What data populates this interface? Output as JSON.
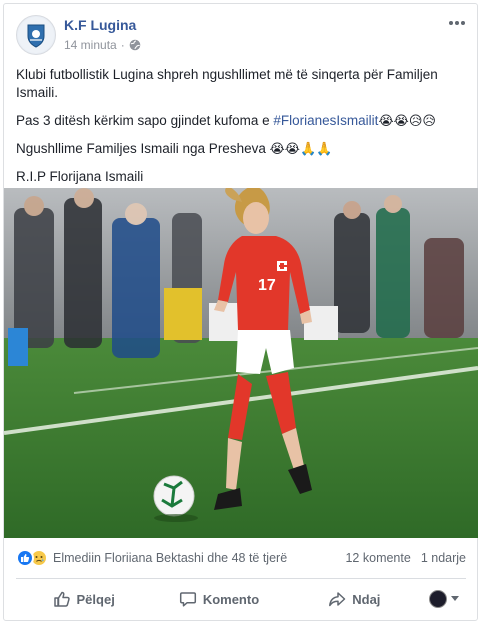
{
  "post": {
    "page_name": "K.F Lugina",
    "time": "14 minuta",
    "privacy_icon": "globe-icon",
    "text": {
      "line1": "Klubi futbollistik Lugina shpreh ngushllimet më të sinqerta për Familjen Ismaili.",
      "line2_prefix": "Pas 3 ditësh kërkim sapo gjindet kufoma e ",
      "hashtag": "#FlorianesIsmailit",
      "line2_emoji": "😭😭😥😥",
      "line3": "Ngushllime Familjes Ismaili nga Presheva ",
      "line3_emoji": "😭😭🙏🙏",
      "line4": "R.I.P Florijana Ismaili"
    }
  },
  "reactions": {
    "icons": [
      "like-icon",
      "sad-icon"
    ],
    "reactors": "Elmediin Floriiana Bektashi dhe 48 të tjerë",
    "comments": "12 komente",
    "shares": "1 ndarje"
  },
  "actions": {
    "like": "Pëlqej",
    "comment": "Komento",
    "share": "Ndaj"
  },
  "colors": {
    "link": "#365899",
    "muted": "#90949c",
    "like_blue": "#1877f2",
    "pitch": "#3a6b2e",
    "kit_red": "#e2372a"
  }
}
